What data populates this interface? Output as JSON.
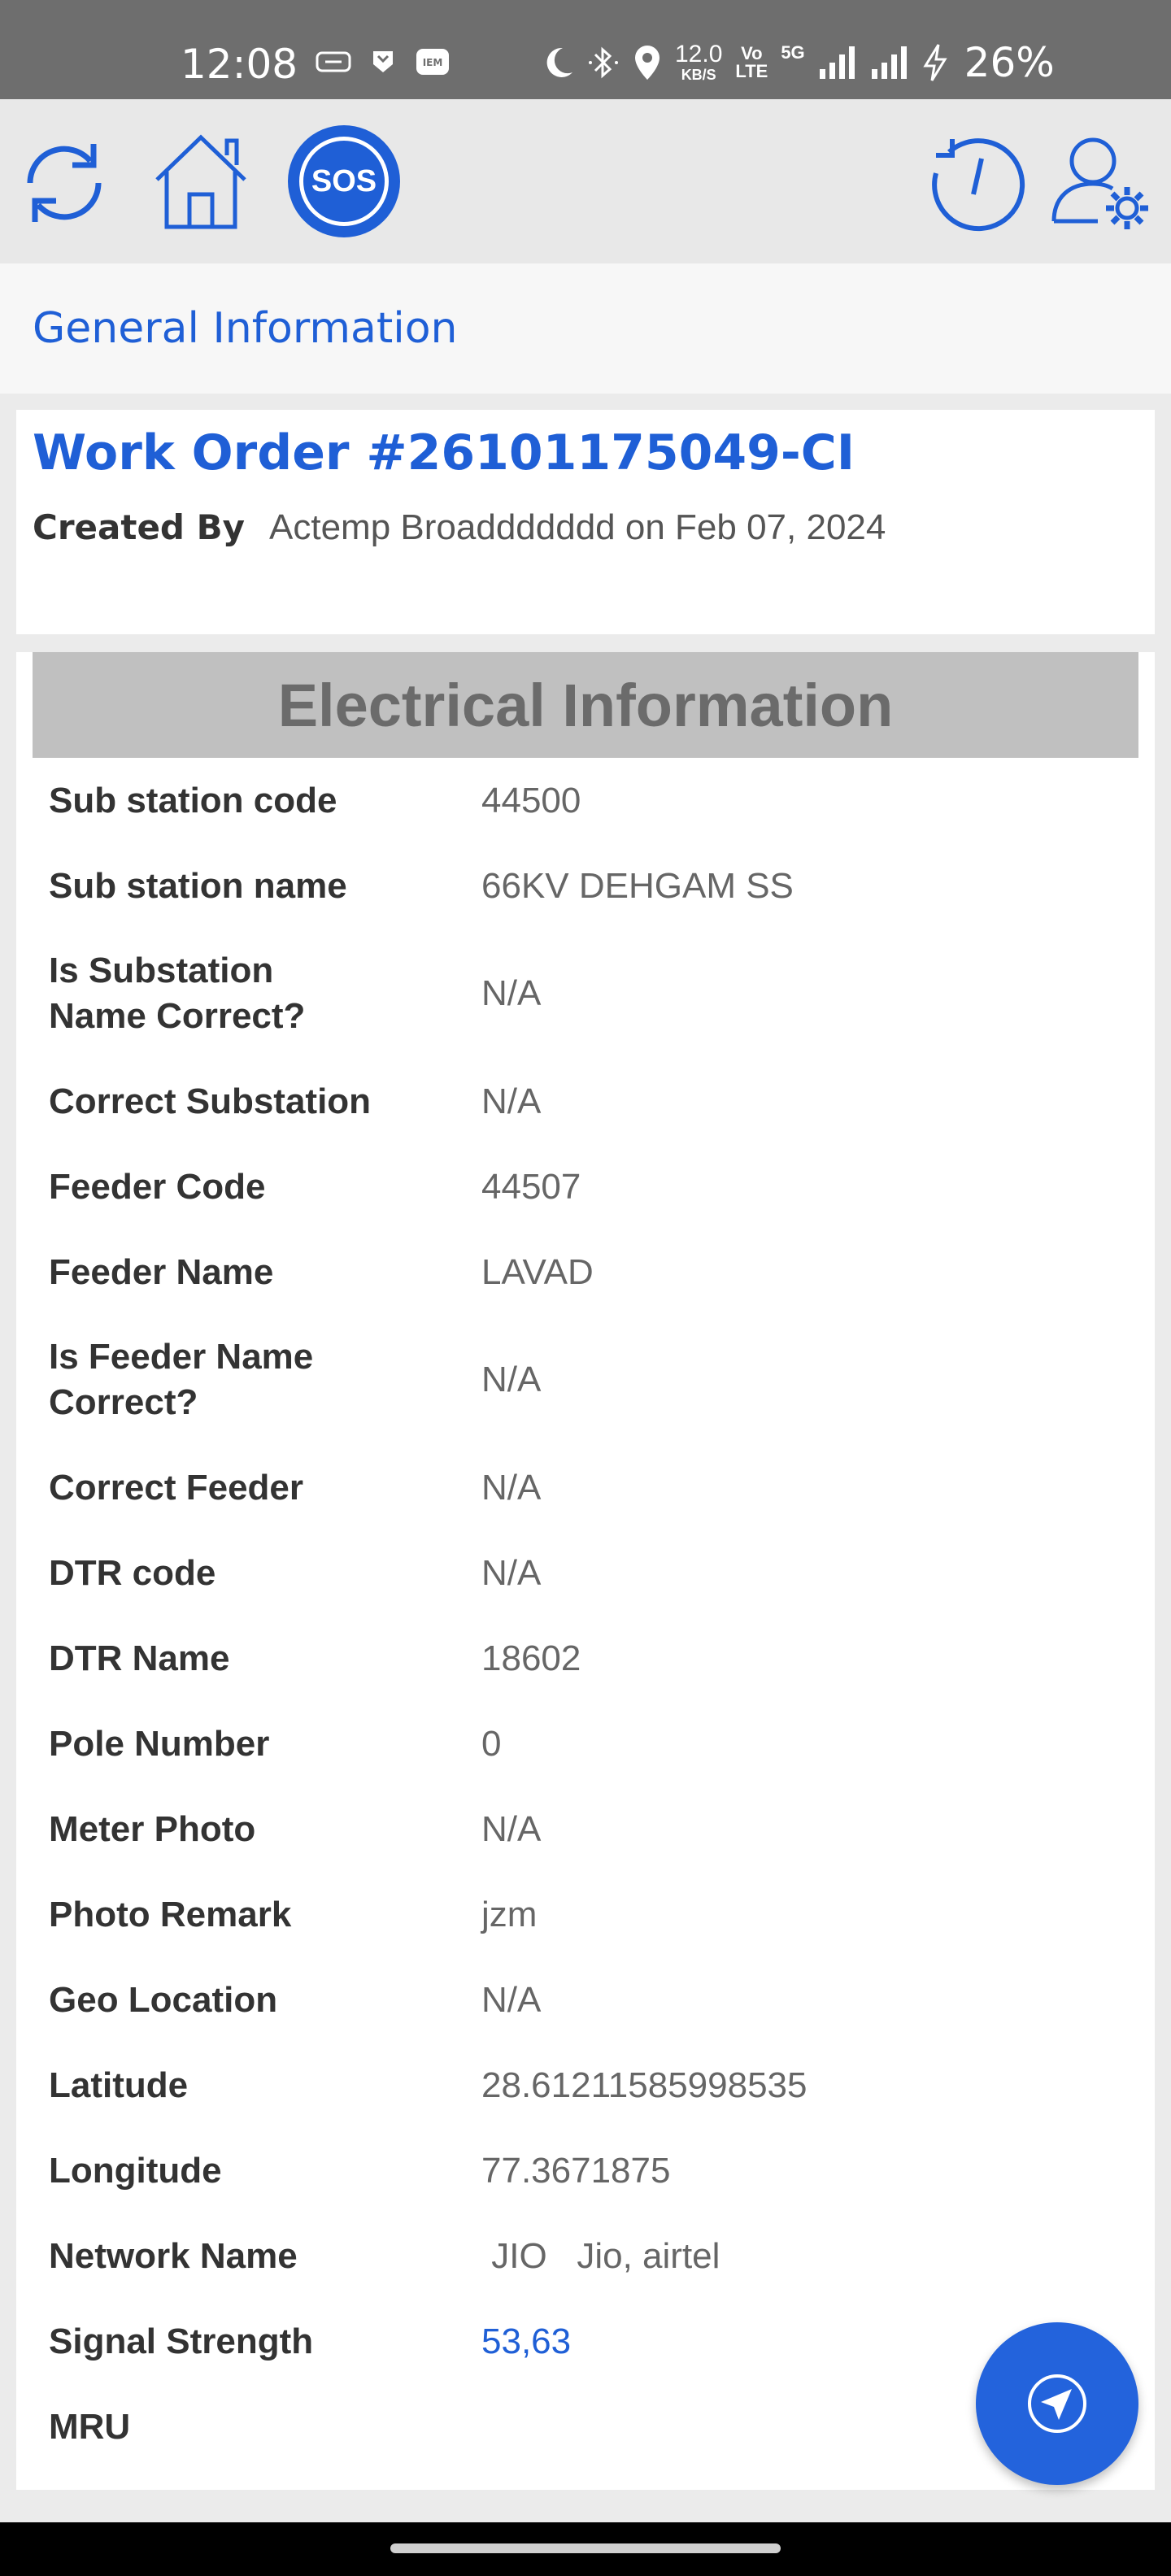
{
  "status_bar": {
    "time": "12:08",
    "speed_value": "12.0",
    "speed_unit": "KB/S",
    "volte_top": "Vo",
    "volte_bottom": "LTE",
    "network": "5G",
    "battery": "26%",
    "icons": [
      "mail-icon",
      "shield-icon",
      "iem-icon",
      "moon-icon",
      "bluetooth-icon",
      "location-icon",
      "signal-icon",
      "signal-icon",
      "charging-icon"
    ]
  },
  "toolbar": {
    "sos_label": "SOS",
    "icons": [
      "refresh-icon",
      "home-icon",
      "sos-icon",
      "history-icon",
      "user-settings-icon"
    ]
  },
  "general": {
    "title": "General Information"
  },
  "work_order": {
    "title": "Work Order #26101175049-CI",
    "created_by_label": "Created By",
    "created_by_value": "Actemp Broaddddddd on Feb 07, 2024"
  },
  "electrical": {
    "heading": "Electrical Information",
    "rows": [
      {
        "label": "Sub station code",
        "value": "44500"
      },
      {
        "label": "Sub station name",
        "value": "66KV DEHGAM SS"
      },
      {
        "label": "Is Substation Name Correct?",
        "value": "N/A"
      },
      {
        "label": "Correct Substation",
        "value": "N/A"
      },
      {
        "label": "Feeder Code",
        "value": "44507"
      },
      {
        "label": "Feeder Name",
        "value": "LAVAD"
      },
      {
        "label": "Is Feeder Name Correct?",
        "value": "N/A"
      },
      {
        "label": "Correct Feeder",
        "value": "N/A"
      },
      {
        "label": "DTR code",
        "value": "N/A"
      },
      {
        "label": "DTR Name",
        "value": "18602"
      },
      {
        "label": "Pole Number",
        "value": "0"
      },
      {
        "label": "Meter Photo",
        "value": "N/A"
      },
      {
        "label": "Photo Remark",
        "value": "jzm"
      },
      {
        "label": "Geo Location",
        "value": "N/A"
      },
      {
        "label": "Latitude",
        "value": "28.61211585998535"
      },
      {
        "label": "Longitude",
        "value": "77.3671875"
      },
      {
        "label": "Network Name",
        "value": " JIO   Jio, airtel"
      },
      {
        "label": "Signal Strength",
        "value": "53,63"
      },
      {
        "label": "MRU",
        "value": ""
      }
    ]
  },
  "colors": {
    "accent": "#1f5fd6",
    "fab": "#2363dc",
    "panel_header": "#c0c0c0"
  }
}
